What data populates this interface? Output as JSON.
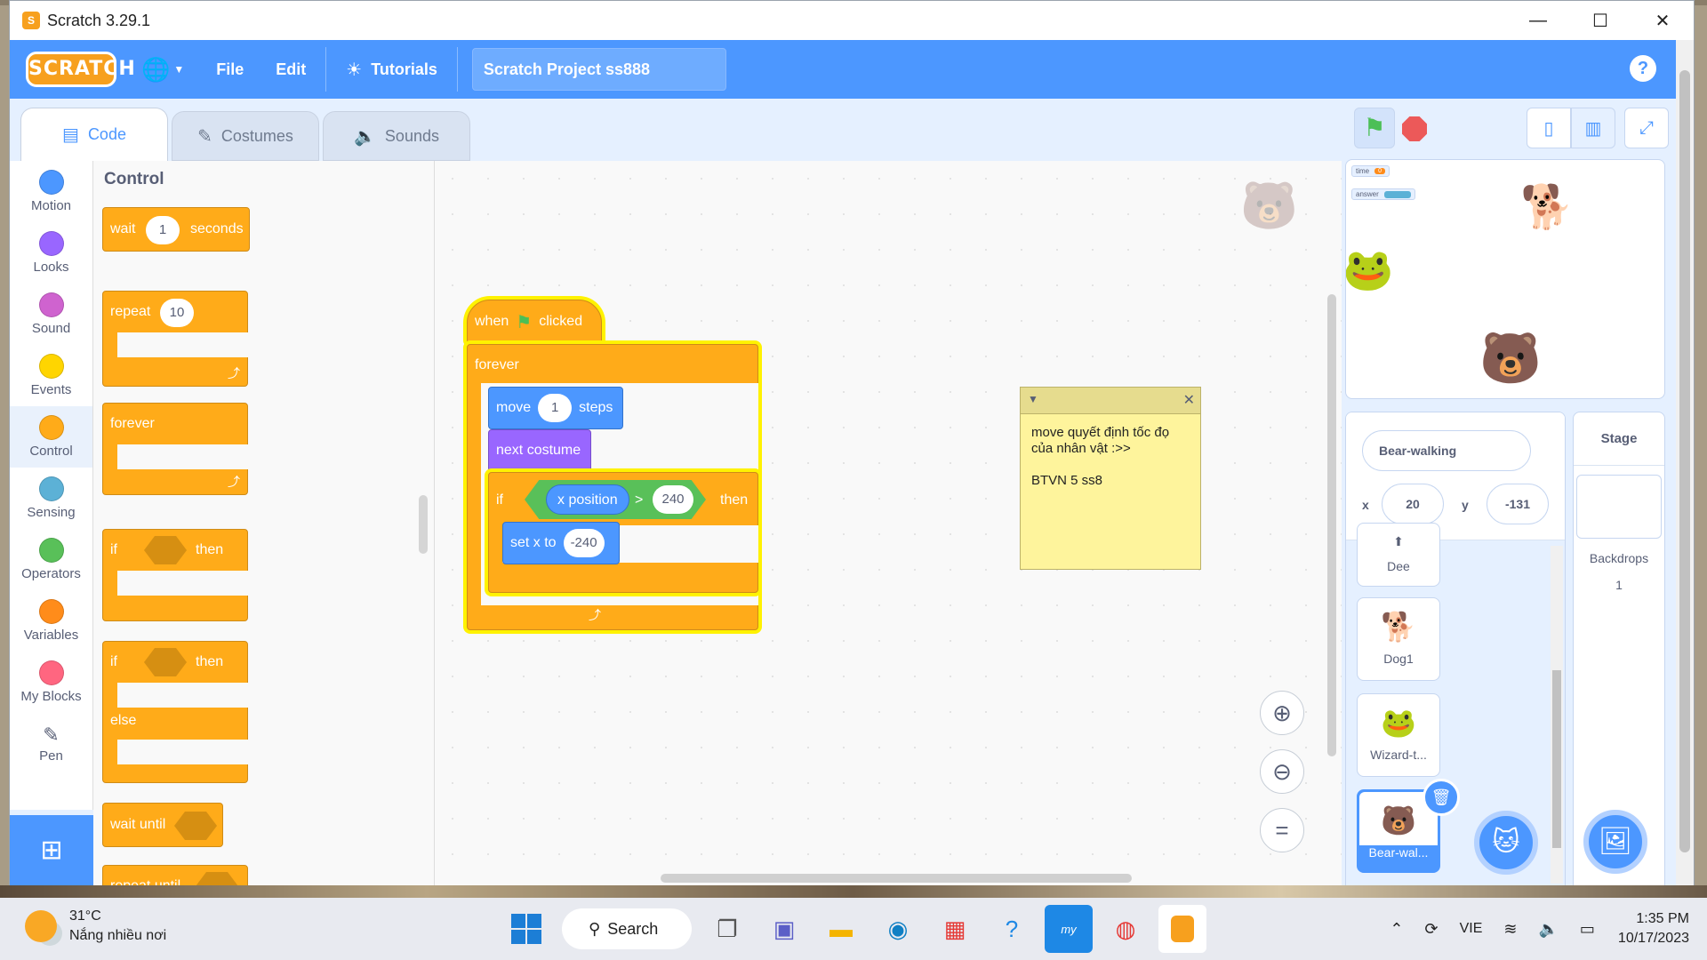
{
  "window": {
    "title": "Scratch 3.29.1",
    "minimize": "—",
    "maximize": "☐",
    "close": "✕"
  },
  "menubar": {
    "logo": "SCRATCH",
    "globe_icon": "🌐",
    "file": "File",
    "edit": "Edit",
    "tutorials": "Tutorials",
    "project_title": "Scratch Project ss888",
    "help": "?"
  },
  "tabs": [
    {
      "label": "Code",
      "icon": "code-icon",
      "active": true
    },
    {
      "label": "Costumes",
      "icon": "brush-icon",
      "active": false
    },
    {
      "label": "Sounds",
      "icon": "speaker-icon",
      "active": false
    }
  ],
  "categories": [
    {
      "label": "Motion",
      "color": "#4c97ff"
    },
    {
      "label": "Looks",
      "color": "#9966ff"
    },
    {
      "label": "Sound",
      "color": "#cf63cf"
    },
    {
      "label": "Events",
      "color": "#ffd500"
    },
    {
      "label": "Control",
      "color": "#ffab19"
    },
    {
      "label": "Sensing",
      "color": "#5cb1d6"
    },
    {
      "label": "Operators",
      "color": "#59c059"
    },
    {
      "label": "Variables",
      "color": "#ff8c1a"
    },
    {
      "label": "My Blocks",
      "color": "#ff6680"
    },
    {
      "label": "Pen",
      "color": "#0fbd8c"
    }
  ],
  "palette": {
    "title": "Control",
    "wait": {
      "pre": "wait",
      "value": "1",
      "post": "seconds"
    },
    "repeat": {
      "pre": "repeat",
      "value": "10"
    },
    "forever": "forever",
    "if_then": {
      "if": "if",
      "then": "then"
    },
    "if_else": {
      "if": "if",
      "then": "then",
      "else": "else"
    },
    "wait_until": "wait until",
    "repeat_until": "repeat until"
  },
  "script": {
    "hat": {
      "when": "when",
      "clicked": "clicked"
    },
    "forever": "forever",
    "move": {
      "pre": "move",
      "value": "1",
      "post": "steps"
    },
    "next_costume": "next costume",
    "if": "if",
    "x_position": "x position",
    "gt": ">",
    "threshold": "240",
    "then": "then",
    "set_x": {
      "pre": "set x to",
      "value": "-240"
    }
  },
  "comment": {
    "text": "move quyết định tốc đọ\ncủa nhân vật :>>\n\nBTVN 5 ss8"
  },
  "stage": {
    "monitors": [
      {
        "label": "time",
        "value": "0"
      },
      {
        "label": "answer",
        "value": ""
      }
    ]
  },
  "sprite_info": {
    "name": "Bear-walking",
    "x_label": "x",
    "x_value": "20",
    "y_label": "y",
    "y_value": "-131"
  },
  "sprites": [
    {
      "name": "Dee"
    },
    {
      "name": "Dog1"
    },
    {
      "name": "Wizard-t..."
    },
    {
      "name": "Bear-wal..."
    }
  ],
  "stage_pane": {
    "title": "Stage",
    "backdrops_label": "Backdrops",
    "backdrops_count": "1"
  },
  "taskbar": {
    "temp": "31°C",
    "weather": "Nắng nhiều nơi",
    "search": "Search",
    "lang": "VIE",
    "time": "1:35 PM",
    "date": "10/17/2023"
  }
}
